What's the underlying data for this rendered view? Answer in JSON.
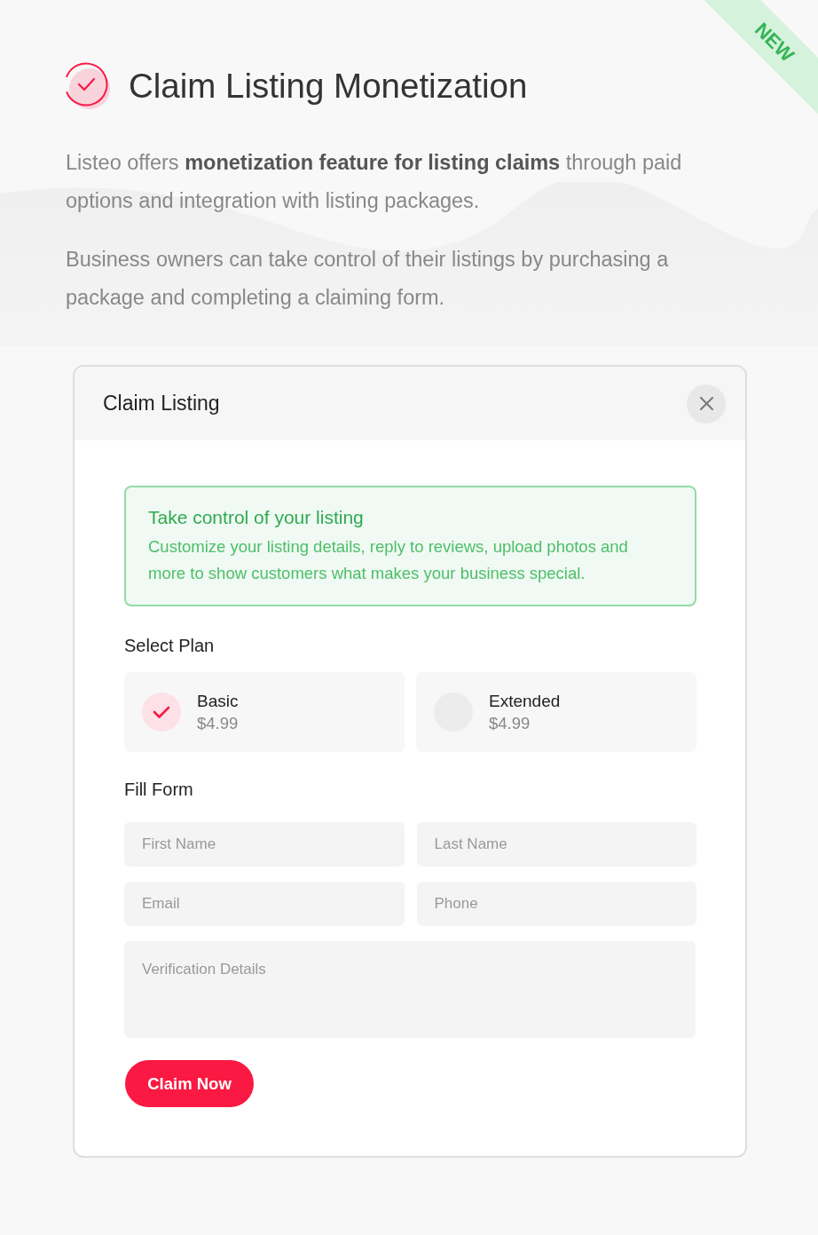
{
  "ribbon": {
    "label": "NEW"
  },
  "header": {
    "title": "Claim Listing Monetization"
  },
  "intro": [
    "Listeo offers **monetization feature for listing claims** through paid options and integration with listing packages.",
    "Business owners can take control of their listings by purchasing a package and completing a claiming form."
  ],
  "dialog": {
    "title": "Claim Listing",
    "notice": {
      "title": "Take control of your listing",
      "text": "Customize your listing details, reply to reviews, upload photos and more to show customers what makes your business special."
    },
    "plan_label": "Select Plan",
    "plans": [
      {
        "name": "Basic",
        "price": "$4.99",
        "selected": true
      },
      {
        "name": "Extended",
        "price": "$4.99",
        "selected": false
      }
    ],
    "form_label": "Fill Form",
    "fields": [
      {
        "kind": "input",
        "placeholder": "First Name"
      },
      {
        "kind": "input",
        "placeholder": "Last Name"
      },
      {
        "kind": "input",
        "placeholder": "Email"
      },
      {
        "kind": "input",
        "placeholder": "Phone"
      },
      {
        "kind": "textarea",
        "placeholder": "Verification Details"
      }
    ],
    "submit": "Claim Now"
  }
}
